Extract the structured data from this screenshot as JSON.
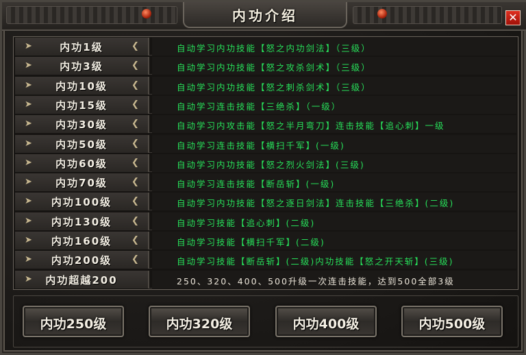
{
  "window": {
    "title": "内功介绍",
    "close_label": "✕"
  },
  "rows": [
    {
      "level": "内功1级",
      "desc": "自动学习内功技能【怒之内功剑法】（三级）"
    },
    {
      "level": "内功3级",
      "desc": "自动学习内功技能【怒之攻杀剑术】（三级）"
    },
    {
      "level": "内功10级",
      "desc": "自动学习内功技能【怒之刺杀剑术】（三级）"
    },
    {
      "level": "内功15级",
      "desc": "自动学习连击技能【三绝杀】（一级）"
    },
    {
      "level": "内功30级",
      "desc": "自动学习内攻击能【怒之半月弯刀】连击技能【追心刺】一级"
    },
    {
      "level": "内功50级",
      "desc": "自动学习连击技能【横扫千军】(一级)"
    },
    {
      "level": "内功60级",
      "desc": "自动学习内功技能【怒之烈火剑法】(三级)"
    },
    {
      "level": "内功70级",
      "desc": "自动学习连击技能【断岳斩】(一级)"
    },
    {
      "level": "内功100级",
      "desc": "自动学习内功技能【怒之逐日剑法】连击技能【三绝杀】(二级)"
    },
    {
      "level": "内功130级",
      "desc": "自动学习技能【追心刺】(二级)"
    },
    {
      "level": "内功160级",
      "desc": "自动学习技能【横扫千军】(二级)"
    },
    {
      "level": "内功200级",
      "desc": "自动学习技能【断岳斩】(二级)内功技能【怒之开天斩】(三级)"
    },
    {
      "level": "内功超越200",
      "desc": "250、320、400、500升级一次连击技能，达到500全部3级"
    }
  ],
  "buttons": [
    "内功250级",
    "内功320级",
    "内功400级",
    "内功500级"
  ],
  "colors": {
    "desc_green": "#27e05a",
    "desc_white": "#ece6da",
    "close_red": "#e03020"
  }
}
